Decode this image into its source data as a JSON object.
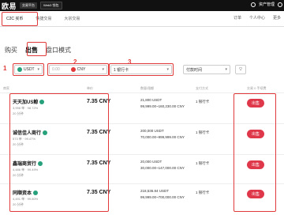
{
  "topbar": {
    "logo": "欧易",
    "btn1": "交易平台",
    "btn2": "Web3 钱包",
    "right_label": "资产管理"
  },
  "subnav": {
    "items": [
      "C2C 买币",
      "快捷交易",
      "大宗交易"
    ],
    "right": [
      "订单",
      "个人中心",
      "更多"
    ]
  },
  "tabs": {
    "buy": "购买",
    "sell": "出售",
    "mode": "盘口模式"
  },
  "labels": {
    "one": "1",
    "two": "2",
    "three": "3"
  },
  "filters": {
    "coin": "USDT",
    "amount_placeholder": "0.00",
    "currency": "CNY",
    "payment": "1 银行卡",
    "time": "付款时间"
  },
  "headers": {
    "merchant": "商家",
    "price": "单价",
    "amount": "数量/限额",
    "payment": "支付方式",
    "action": "交易 0 手续费"
  },
  "rows": [
    {
      "name": "天天加US鲸",
      "stats": "3,998 单 · 98.72%",
      "time": "20 分钟",
      "price": "7.35 CNY",
      "amount": "21,800 USDT",
      "limit": "99,999.00~160,230.00 CNY",
      "pay": "1 银行卡",
      "action": "出售"
    },
    {
      "name": "诚信佳人商行",
      "stats": "573 单 · 99.47%",
      "time": "20 分钟",
      "price": "7.35 CNY",
      "amount": "200,000 USDT",
      "limit": "70,000.00~999,999.00 CNY",
      "pay": "1 银行卡",
      "action": "出售"
    },
    {
      "name": "鑫瑞商贸行",
      "stats": "4,486 单 · 99.49%",
      "time": "20 分钟",
      "price": "7.35 CNY",
      "amount": "20,000 USDT",
      "limit": "30,000.00~147,000.00 CNY",
      "pay": "1 银行卡",
      "action": "出售"
    },
    {
      "name": "同顺资本",
      "stats": "4,491 单 · 99.80%",
      "time": "20 分钟",
      "price": "7.35 CNY",
      "amount": "218,536.84 USDT",
      "limit": "99,999.00~700,000.00 CNY",
      "pay": "1 银行卡",
      "action": "出售"
    }
  ]
}
